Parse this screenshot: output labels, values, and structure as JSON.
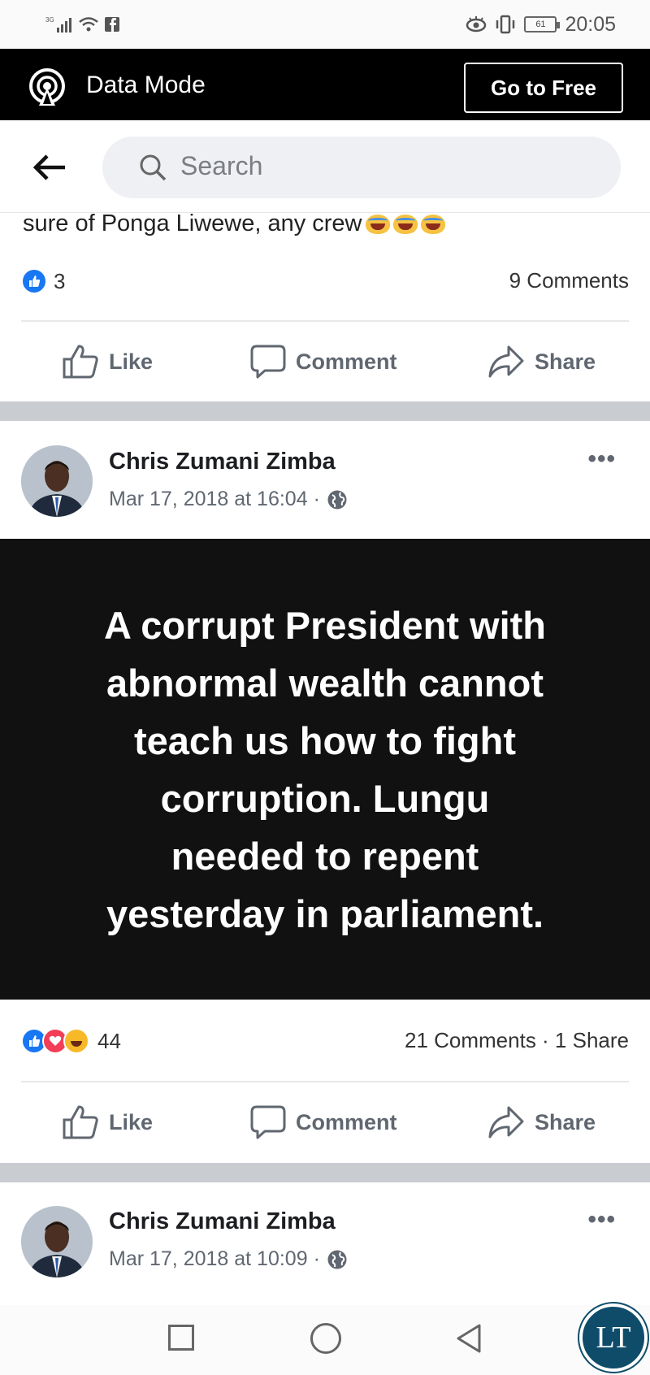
{
  "status_bar": {
    "network_label": "3G",
    "time": "20:05",
    "battery": "61"
  },
  "data_bar": {
    "mode_label": "Data Mode",
    "go_free_label": "Go to Free"
  },
  "search": {
    "placeholder": "Search"
  },
  "posts": [
    {
      "clipped_text": "sure of Ponga Liwewe, any crew",
      "reaction_count": "3",
      "comments_summary": "9 Comments",
      "actions": {
        "like": "Like",
        "comment": "Comment",
        "share": "Share"
      }
    },
    {
      "author": "Chris Zumani Zimba",
      "timestamp": "Mar 17, 2018 at 16:04 ·",
      "more_label": "•••",
      "quote": "A corrupt President with\nabnormal wealth cannot\nteach us how to fight\ncorruption. Lungu\nneeded to repent\nyesterday in parliament.",
      "reaction_count": "44",
      "comments_summary": "21 Comments · 1 Share",
      "actions": {
        "like": "Like",
        "comment": "Comment",
        "share": "Share"
      }
    },
    {
      "author": "Chris Zumani Zimba",
      "timestamp": "Mar 17, 2018 at 10:09 ·",
      "more_label": "•••"
    }
  ],
  "watermark": {
    "text": "LT"
  },
  "colors": {
    "facebook_blue": "#1877f2",
    "love_red": "#f33e58",
    "haha_yellow": "#f7b928",
    "separator_gray": "#c9ccd1"
  },
  "icons": [
    "signal-icon",
    "wifi-icon",
    "facebook-notification-icon",
    "eye-comfort-icon",
    "vibrate-icon",
    "battery-icon",
    "data-mode-icon",
    "back-arrow-icon",
    "search-icon",
    "like-icon",
    "comment-icon",
    "share-icon",
    "globe-icon",
    "more-icon"
  ]
}
